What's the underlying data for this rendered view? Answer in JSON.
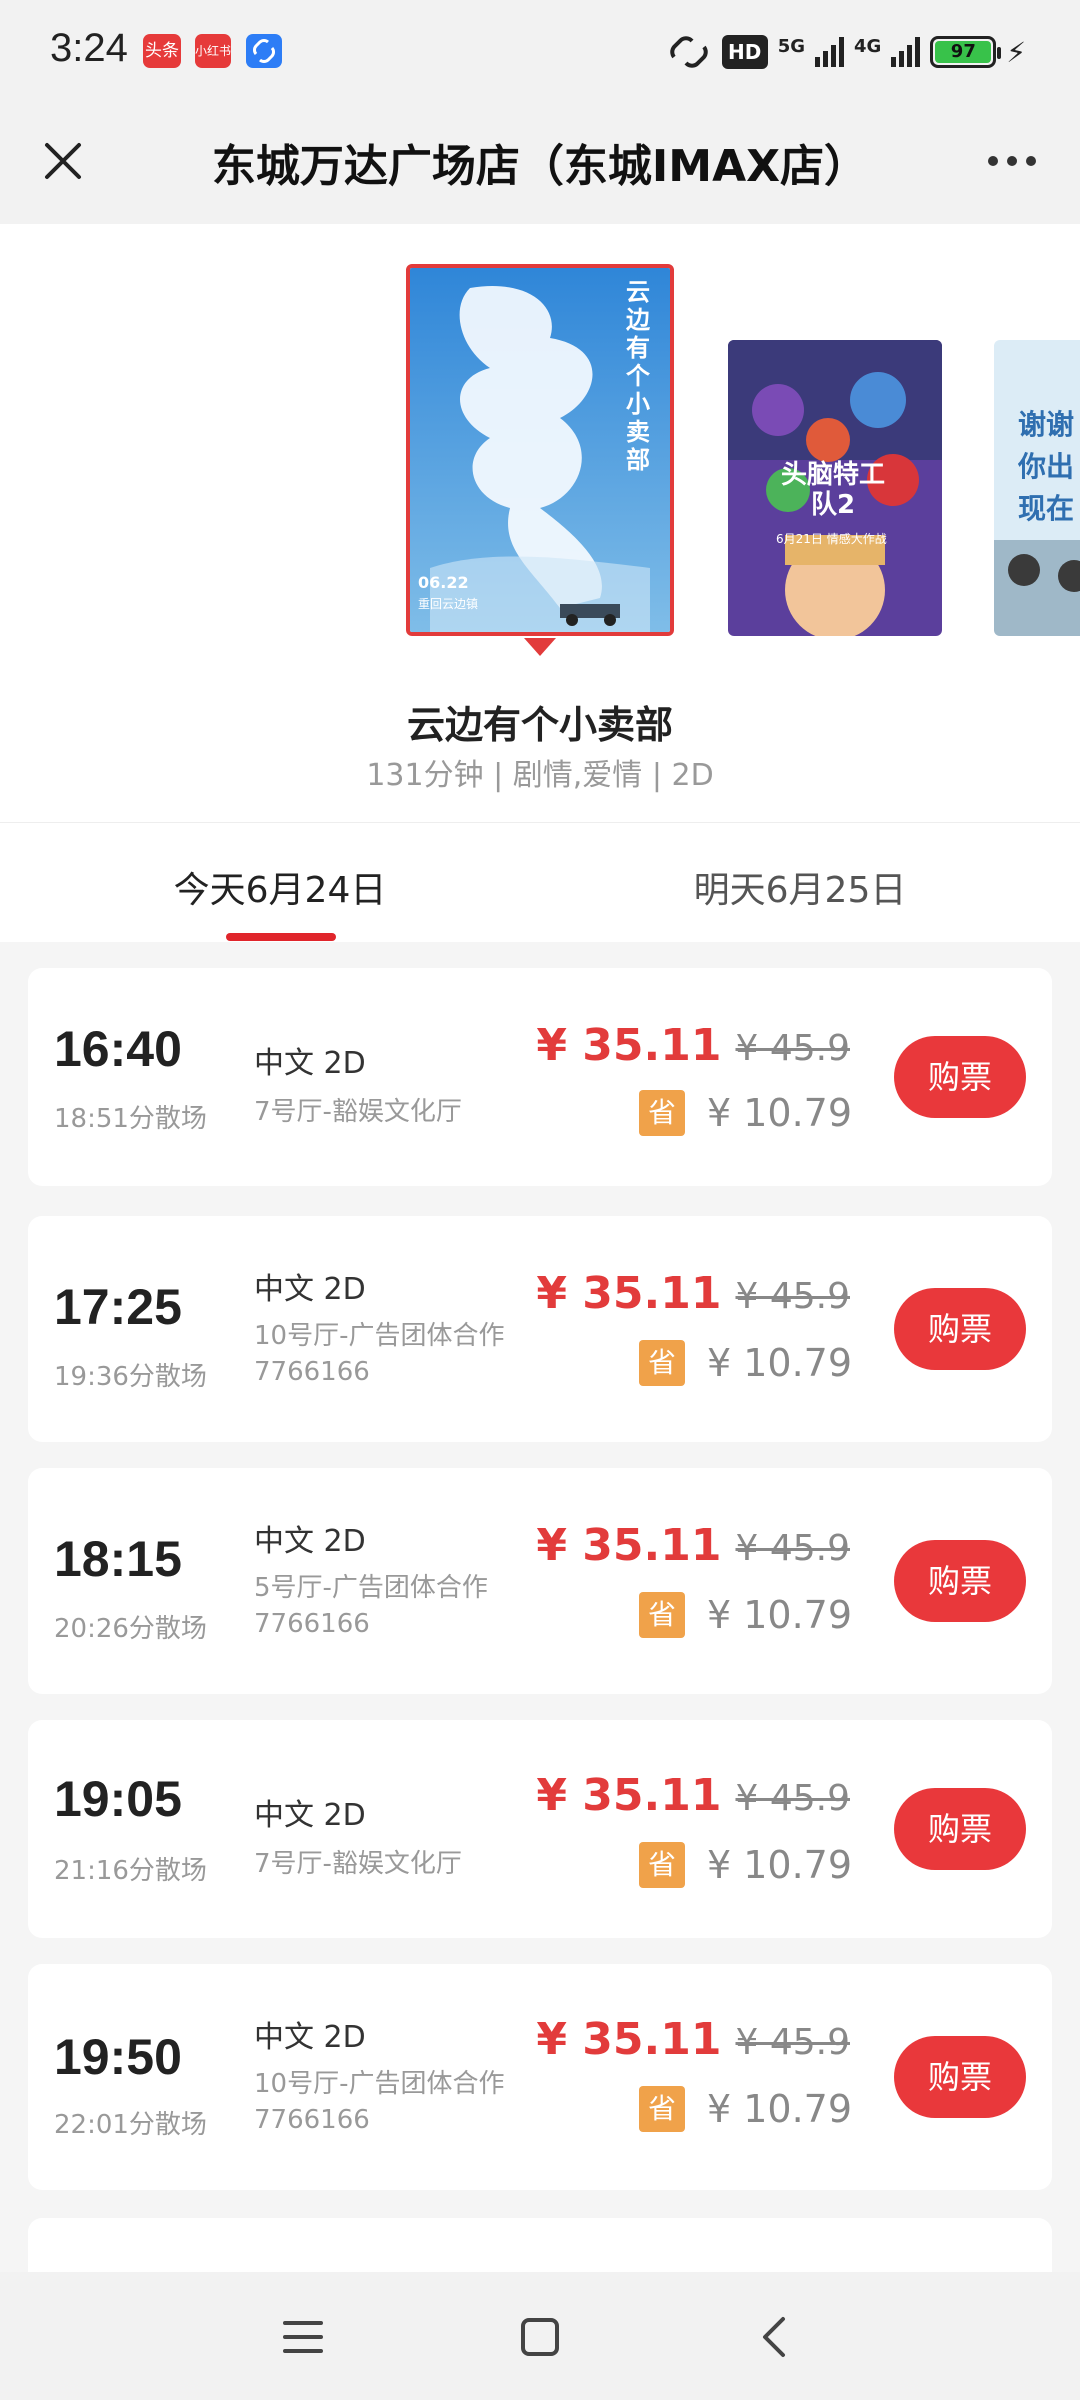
{
  "status_bar": {
    "time": "3:24",
    "apps": [
      "头条",
      "小红书",
      "link-app-icon"
    ],
    "hd": "HD",
    "net1": "5G",
    "net2": "4G",
    "battery": "97"
  },
  "header": {
    "title": "东城万达广场店（东城IMAX店）"
  },
  "movie": {
    "name": "云边有个小卖部",
    "meta": "131分钟 | 剧情,爱情 | 2D",
    "poster_main_date": "06.22",
    "poster_main_caption": "重回云边镇",
    "poster_main_title": "云边有个小卖部",
    "poster2_title": "头脑特工队2",
    "poster2_date": "6月21日 情感大作战",
    "poster3_title": "谢谢你出现在我的青春"
  },
  "tabs": [
    {
      "label": "今天6月24日",
      "active": true
    },
    {
      "label": "明天6月25日",
      "active": false
    }
  ],
  "showtimes": [
    {
      "time": "16:40",
      "end": "18:51分散场",
      "lang": "中文 2D",
      "hall": "7号厅-豁娱文化厅",
      "price": "¥ 35.11",
      "orig": "¥ 45.9",
      "save_label": "省",
      "save": "¥ 10.79",
      "buy": "购票"
    },
    {
      "time": "17:25",
      "end": "19:36分散场",
      "lang": "中文 2D",
      "hall": "10号厅-广告团体合作7766166",
      "price": "¥ 35.11",
      "orig": "¥ 45.9",
      "save_label": "省",
      "save": "¥ 10.79",
      "buy": "购票"
    },
    {
      "time": "18:15",
      "end": "20:26分散场",
      "lang": "中文 2D",
      "hall": "5号厅-广告团体合作7766166",
      "price": "¥ 35.11",
      "orig": "¥ 45.9",
      "save_label": "省",
      "save": "¥ 10.79",
      "buy": "购票"
    },
    {
      "time": "19:05",
      "end": "21:16分散场",
      "lang": "中文 2D",
      "hall": "7号厅-豁娱文化厅",
      "price": "¥ 35.11",
      "orig": "¥ 45.9",
      "save_label": "省",
      "save": "¥ 10.79",
      "buy": "购票"
    },
    {
      "time": "19:50",
      "end": "22:01分散场",
      "lang": "中文 2D",
      "hall": "10号厅-广告团体合作7766166",
      "price": "¥ 35.11",
      "orig": "¥ 45.9",
      "save_label": "省",
      "save": "¥ 10.79",
      "buy": "购票"
    }
  ],
  "colors": {
    "accent": "#e23b3b",
    "save_badge": "#f0a24a",
    "battery": "#38c24a"
  },
  "icons": [
    "close-icon",
    "more-icon",
    "menu-icon",
    "home-icon",
    "back-icon"
  ]
}
